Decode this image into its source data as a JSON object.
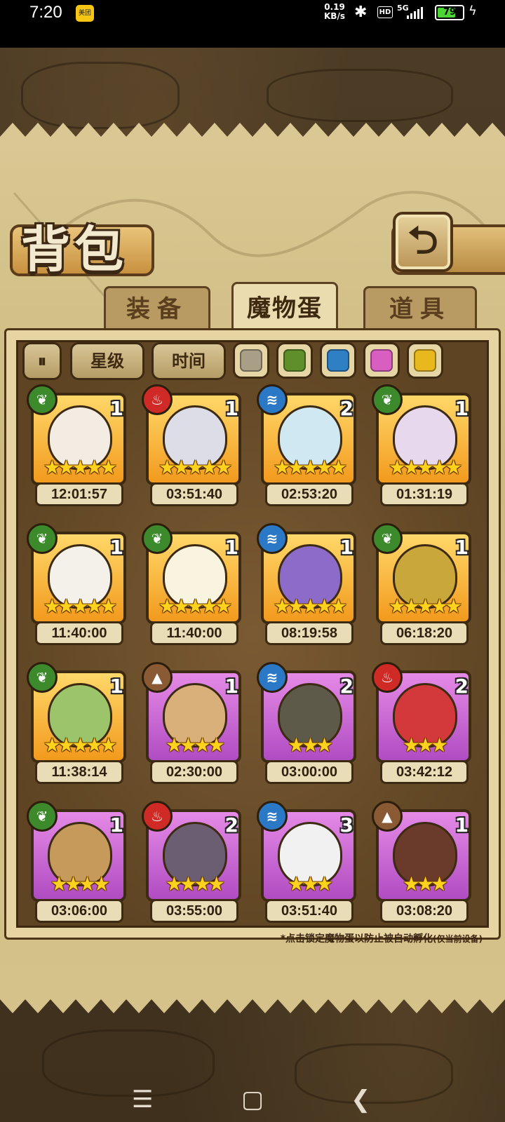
{
  "status_bar": {
    "time": "7:20",
    "app_badge": "美团",
    "net_speed_top": "0.19",
    "net_speed_bottom": "KB/s",
    "bluetooth_icon": "bluetooth-icon",
    "hd_label": "HD",
    "network_type": "5G",
    "battery_level": "79",
    "charging_icon": "bolt-icon"
  },
  "header": {
    "title": "背包",
    "back_icon": "return-arrow-icon"
  },
  "tabs": [
    {
      "label": "装备",
      "active": false
    },
    {
      "label": "魔物蛋",
      "active": true
    },
    {
      "label": "道具",
      "active": false
    }
  ],
  "filters": {
    "toggle_icon": "pause-toggle-icon",
    "star_label": "星级",
    "time_label": "时间",
    "colors": [
      {
        "name": "gray",
        "hex": "#a89f86"
      },
      {
        "name": "green",
        "hex": "#5f8f2b"
      },
      {
        "name": "blue",
        "hex": "#2f7fc4"
      },
      {
        "name": "pink",
        "hex": "#d85ec0"
      },
      {
        "name": "yellow",
        "hex": "#e8b81e"
      }
    ]
  },
  "element_colors": {
    "grass": "#3d8a2c",
    "fire": "#cf2a26",
    "water": "#2a78c6",
    "earth": "#8a5a34"
  },
  "eggs": [
    {
      "element": "grass",
      "count": "1",
      "stars": 5,
      "rarity": "gold",
      "time": "12:01:57",
      "art": "#f2ece2"
    },
    {
      "element": "fire",
      "count": "1",
      "stars": 5,
      "rarity": "gold",
      "time": "03:51:40",
      "art": "#dcdde6"
    },
    {
      "element": "water",
      "count": "2",
      "stars": 5,
      "rarity": "gold",
      "time": "02:53:20",
      "art": "#cfe8f2"
    },
    {
      "element": "grass",
      "count": "1",
      "stars": 5,
      "rarity": "gold",
      "time": "01:31:19",
      "art": "#e7d8ee"
    },
    {
      "element": "grass",
      "count": "1",
      "stars": 5,
      "rarity": "gold",
      "time": "11:40:00",
      "art": "#f4f1ea"
    },
    {
      "element": "grass",
      "count": "1",
      "stars": 5,
      "rarity": "gold",
      "time": "11:40:00",
      "art": "#f8f4e0"
    },
    {
      "element": "water",
      "count": "1",
      "stars": 5,
      "rarity": "gold",
      "time": "08:19:58",
      "art": "#8d6cc9"
    },
    {
      "element": "grass",
      "count": "1",
      "stars": 5,
      "rarity": "gold",
      "time": "06:18:20",
      "art": "#c9a73a"
    },
    {
      "element": "grass",
      "count": "1",
      "stars": 5,
      "rarity": "gold",
      "time": "11:38:14",
      "art": "#9cc46b"
    },
    {
      "element": "earth",
      "count": "1",
      "stars": 4,
      "rarity": "purple",
      "time": "02:30:00",
      "art": "#d9b07a"
    },
    {
      "element": "water",
      "count": "2",
      "stars": 3,
      "rarity": "purple",
      "time": "03:00:00",
      "art": "#5e5a4a"
    },
    {
      "element": "fire",
      "count": "2",
      "stars": 3,
      "rarity": "purple",
      "time": "03:42:12",
      "art": "#d3393a"
    },
    {
      "element": "grass",
      "count": "1",
      "stars": 4,
      "rarity": "purple",
      "time": "03:06:00",
      "art": "#c59a5a"
    },
    {
      "element": "fire",
      "count": "2",
      "stars": 4,
      "rarity": "purple",
      "time": "03:55:00",
      "art": "#6b5e73"
    },
    {
      "element": "water",
      "count": "3",
      "stars": 3,
      "rarity": "purple",
      "time": "03:51:40",
      "art": "#f1f1f1"
    },
    {
      "element": "earth",
      "count": "1",
      "stars": 3,
      "rarity": "purple",
      "time": "03:08:20",
      "art": "#6a3a2a"
    }
  ],
  "footnote": {
    "main": "*点击锁定魔物蛋以防止被自动孵化",
    "small": "(仅当前设备)"
  },
  "nav": {
    "menu_icon": "menu-icon",
    "home_icon": "home-icon",
    "back_icon": "back-icon"
  }
}
